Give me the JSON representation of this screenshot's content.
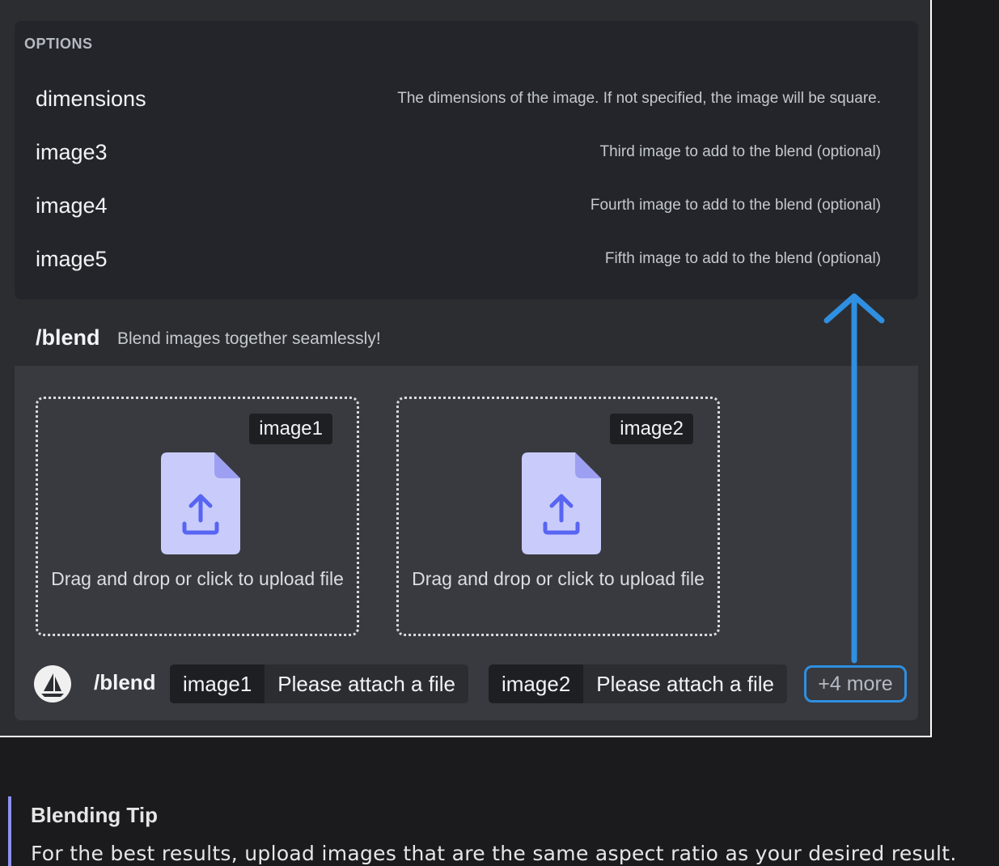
{
  "options": {
    "header": "OPTIONS",
    "items": [
      {
        "name": "dimensions",
        "desc": "The dimensions of the image. If not specified, the image will be square."
      },
      {
        "name": "image3",
        "desc": "Third image to add to the blend (optional)"
      },
      {
        "name": "image4",
        "desc": "Fourth image to add to the blend (optional)"
      },
      {
        "name": "image5",
        "desc": "Fifth image to add to the blend (optional)"
      }
    ]
  },
  "command": {
    "name": "/blend",
    "desc": "Blend images together seamlessly!",
    "dropzones": [
      {
        "tag": "image1",
        "text": "Drag and drop or click to upload file",
        "icon": "upload-file-icon"
      },
      {
        "tag": "image2",
        "text": "Drag and drop or click to upload file",
        "icon": "upload-file-icon"
      }
    ]
  },
  "bar": {
    "cmd": "/blend",
    "params": [
      {
        "name": "image1",
        "value": "Please attach a file"
      },
      {
        "name": "image2",
        "value": "Please attach a file"
      }
    ],
    "more": "+4 more",
    "avatar_icon": "bot-avatar-icon"
  },
  "tip": {
    "title": "Blending Tip",
    "text": "For the best results, upload images that are the same aspect ratio as your desired result."
  },
  "colors": {
    "accent_arrow": "#2f8fe0",
    "tip_border": "#8e91f0",
    "upload_icon": "#c9ccfb",
    "upload_icon_fold": "#9da0f2"
  }
}
